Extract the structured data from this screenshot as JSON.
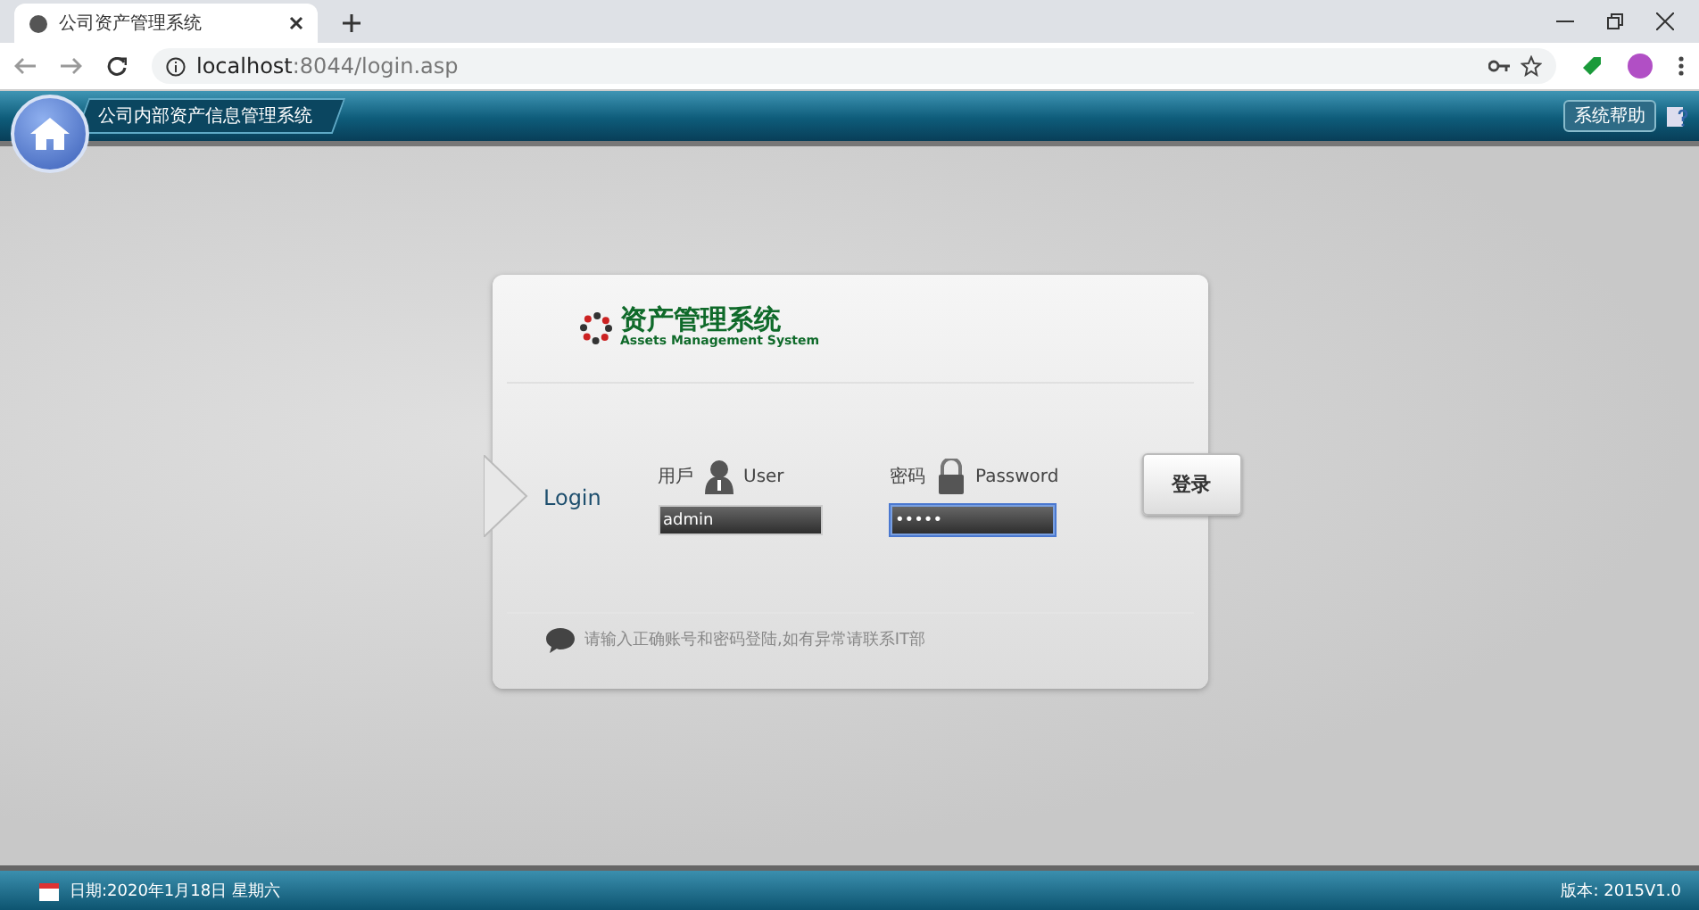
{
  "browser": {
    "tab_title": "公司资产管理系统",
    "url_host": "localhost",
    "url_path": ":8044/login.asp"
  },
  "header": {
    "title": "公司内部资产信息管理系统",
    "help": "系统帮助"
  },
  "login": {
    "logo_title": "资产管理系统",
    "logo_subtitle": "Assets Management System",
    "label": "Login",
    "fields": [
      {
        "label_cn": "用戶",
        "label_en": "User",
        "kind": "user",
        "value": "admin",
        "focused": false
      },
      {
        "label_cn": "密码",
        "label_en": "Password",
        "kind": "password",
        "value": "•••••",
        "focused": true
      }
    ],
    "button": "登录",
    "hint": "请输入正确账号和密码登陆,如有异常请联系IT部"
  },
  "footer": {
    "date": "日期:2020年1月18日 星期六",
    "version": "版本: 2015V1.0"
  }
}
